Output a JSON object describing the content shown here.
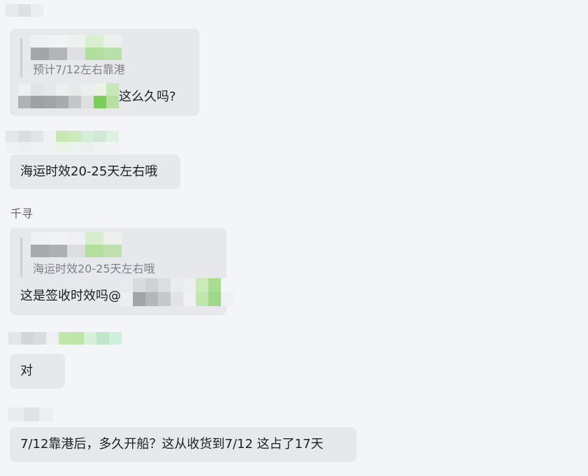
{
  "messages": [
    {
      "quote": "预计7/12左右靠港",
      "text_suffix": "这么久吗?"
    },
    {
      "text": "海运时效20-25天左右哦"
    },
    {
      "sender": "千寻",
      "quote": "海运时效20-25天左右哦",
      "text": "这是签收时效吗@"
    },
    {
      "text": "对"
    },
    {
      "text": "7/12靠港后，多久开船？这从收货到7/12 这占了17天"
    }
  ],
  "colors": {
    "background": "#f4f5f9",
    "bubble": "#e6e8ec",
    "quote_text": "#7d8087",
    "mosaic_green": "#86d26b"
  },
  "icons": [
    "redacted-name-mosaic",
    "redacted-avatar-mosaic"
  ]
}
